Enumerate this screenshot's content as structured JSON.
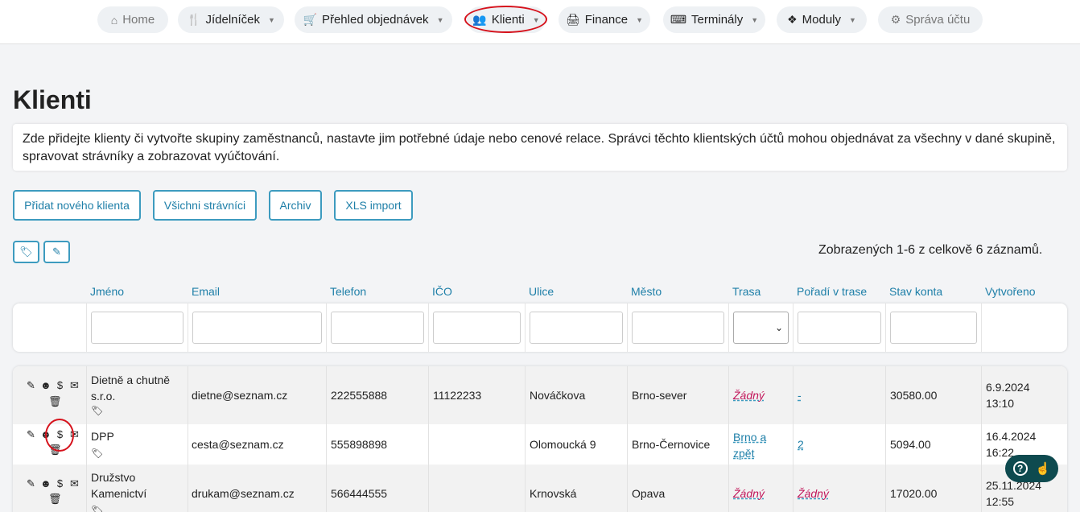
{
  "nav": {
    "items": [
      {
        "label": "Home",
        "icon": "home-icon",
        "dropdown": false
      },
      {
        "label": "Jídelníček",
        "icon": "cutlery-icon",
        "dropdown": true
      },
      {
        "label": "Přehled objednávek",
        "icon": "basket-icon",
        "dropdown": true
      },
      {
        "label": "Klienti",
        "icon": "users-icon",
        "dropdown": true
      },
      {
        "label": "Finance",
        "icon": "cash-register-icon",
        "dropdown": true
      },
      {
        "label": "Terminály",
        "icon": "keyboard-icon",
        "dropdown": true
      },
      {
        "label": "Moduly",
        "icon": "cubes-icon",
        "dropdown": true
      },
      {
        "label": "Správa účtu",
        "icon": "gear-icon",
        "dropdown": false
      }
    ]
  },
  "page": {
    "title": "Klienti",
    "info": "Zde přidejte klienty či vytvořte skupiny zaměstnanců, nastavte jim potřebné údaje nebo cenové relace. Správci těchto klientských účtů mohou objednávat za všechny v dané skupině, spravovat strávníky a zobrazovat vyúčtování."
  },
  "buttons": {
    "add_client": "Přidat nového klienta",
    "all_diners": "Všichni strávníci",
    "archive": "Archiv",
    "xls_import": "XLS import"
  },
  "records_info": "Zobrazených 1-6 z celkově 6 záznamů.",
  "columns": [
    "Jméno",
    "Email",
    "Telefon",
    "IČO",
    "Ulice",
    "Město",
    "Trasa",
    "Pořadí v trase",
    "Stav konta",
    "Vytvořeno"
  ],
  "rows": [
    {
      "name": [
        "Dietně a chutně",
        "s.r.o."
      ],
      "email": "dietne@seznam.cz",
      "phone": "222555888",
      "ico": "11122233",
      "street": "Nováčkova",
      "city": "Brno-sever",
      "route": "Žádný",
      "route_order": "-",
      "balance": "30580.00",
      "created": [
        "6.9.2024",
        "13:10"
      ]
    },
    {
      "name": [
        "DPP"
      ],
      "email": "cesta@seznam.cz",
      "phone": "555898898",
      "ico": "",
      "street": "Olomoucká 9",
      "city": "Brno-Černovice",
      "route": [
        "Brno a",
        "zpět"
      ],
      "route_order": "2",
      "balance": "5094.00",
      "created": [
        "16.4.2024",
        "16:22"
      ]
    },
    {
      "name": [
        "Družstvo",
        "Kamenictví"
      ],
      "email": "drukam@seznam.cz",
      "phone": "566444555",
      "ico": "",
      "street": "Krnovská",
      "city": "Opava",
      "route": "Žádný",
      "route_order": "Žádný",
      "balance": "17020.00",
      "created": [
        "25.11.2024",
        "12:55"
      ]
    }
  ],
  "colors": {
    "accent": "#1e7fa8",
    "accent_border": "#3d9bbf",
    "highlight_circle": "#d6121c",
    "route_none": "#c2185b",
    "help_bg": "#0e4a4f"
  }
}
